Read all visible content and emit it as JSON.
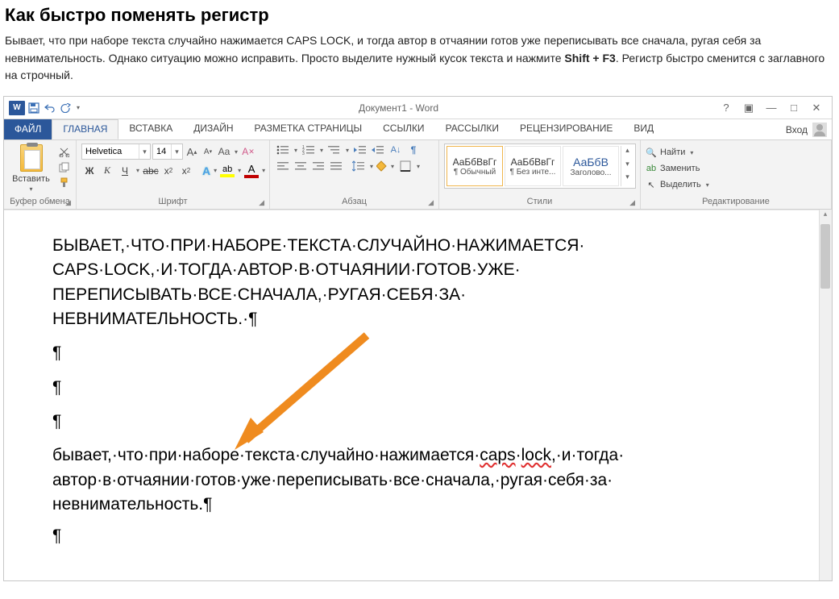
{
  "article": {
    "title": "Как быстро поменять регистр",
    "p1_a": "Бывает, что при наборе текста случайно нажимается CAPS LOCK, и тогда автор в отчаянии готов уже переписывать все сначала, ругая себя за невнимательность. Однако ситуацию можно исправить. Просто выделите нужный кусок текста и нажмите ",
    "shortcut": "Shift + F3",
    "p1_b": ". Регистр быстро сменится с заглавного на строчный."
  },
  "window": {
    "title": "Документ1 - Word",
    "tabs": {
      "file": "ФАЙЛ",
      "home": "ГЛАВНАЯ",
      "insert": "ВСТАВКА",
      "design": "ДИЗАЙН",
      "layout": "РАЗМЕТКА СТРАНИЦЫ",
      "references": "ССЫЛКИ",
      "mailings": "РАССЫЛКИ",
      "review": "РЕЦЕНЗИРОВАНИЕ",
      "view": "ВИД",
      "signin": "Вход"
    },
    "ribbon": {
      "clipboard": {
        "paste": "Вставить",
        "group": "Буфер обмена"
      },
      "font": {
        "name": "Helvetica",
        "size": "14",
        "group": "Шрифт",
        "grow": "A",
        "shrink": "A",
        "case": "Aa",
        "clear": "✕",
        "bold": "Ж",
        "italic": "К",
        "underline": "Ч",
        "strike": "abc",
        "sub": "x₂",
        "sup": "x²",
        "texteffect": "A",
        "highlight": "ab",
        "fontcolor": "A",
        "highlight_color": "#ffff00",
        "fontcolor_color": "#c00000",
        "effect_color": "#4aa0e6"
      },
      "paragraph": {
        "group": "Абзац"
      },
      "styles": {
        "group": "Стили",
        "sample": "АаБбВвГг",
        "s1": "¶ Обычный",
        "s2": "¶ Без инте...",
        "s3_sample": "АаБбВ",
        "s3": "Заголово..."
      },
      "editing": {
        "group": "Редактирование",
        "find": "Найти",
        "replace": "Заменить",
        "select": "Выделить"
      }
    }
  },
  "document": {
    "p1": "БЫВАЕТ,·ЧТО·ПРИ·НАБОРЕ·ТЕКСТА·СЛУЧАЙНО·НАЖИМАЕТСЯ·",
    "p2": "CAPS·LOCK,·И·ТОГДА·АВТОР·В·ОТЧАЯНИИ·ГОТОВ·УЖЕ·",
    "p3": "ПЕРЕПИСЫВАТЬ·ВСЕ·СНАЧАЛА,·РУГАЯ·СЕБЯ·ЗА·",
    "p4": "НЕВНИМАТЕЛЬНОСТЬ.·¶",
    "pil": "¶",
    "l1a": "бывает,·что·при·наборе·текста·случайно·нажимается·",
    "l1b": "caps",
    "l1c": "·",
    "l1d": "lock",
    "l1e": ",·и·тогда·",
    "l2": "автор·в·отчаянии·готов·уже·переписывать·все·сначала,·ругая·себя·за·",
    "l3": "невнимательность.¶"
  }
}
